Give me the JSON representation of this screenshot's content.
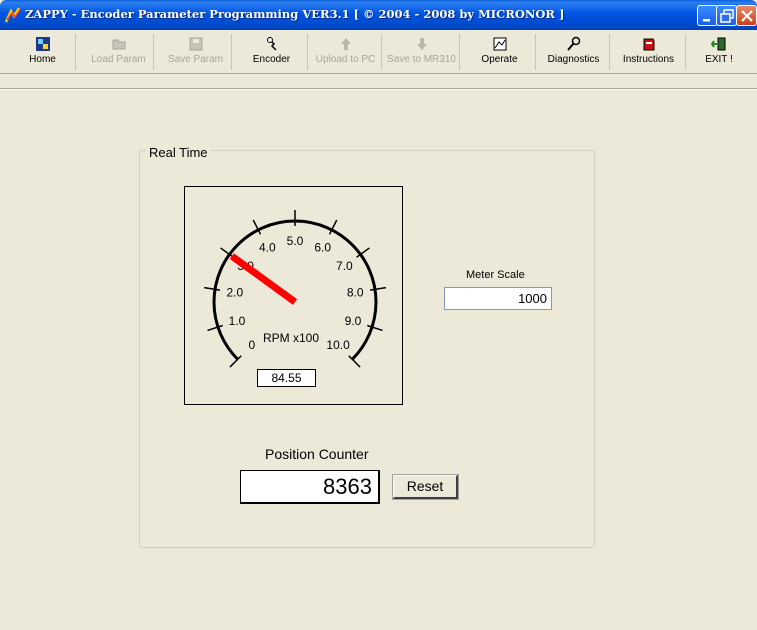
{
  "window": {
    "title": "ZAPPY - Encoder Parameter Programming  VER3.1 [ © 2004 - 2008 by MICRONOR ]"
  },
  "toolbar": {
    "items": [
      {
        "label": "Home",
        "icon": "home-icon",
        "enabled": true
      },
      {
        "label": "Load Param",
        "icon": "folder-icon",
        "enabled": false
      },
      {
        "label": "Save Param",
        "icon": "disk-icon",
        "enabled": false
      },
      {
        "label": "Encoder",
        "icon": "encoder-icon",
        "enabled": true
      },
      {
        "label": "Upload to PC",
        "icon": "up-arrow-icon",
        "enabled": false
      },
      {
        "label": "Save to MR310",
        "icon": "down-arrow-icon",
        "enabled": false
      },
      {
        "label": "Operate",
        "icon": "operate-icon",
        "enabled": true
      },
      {
        "label": "Diagnostics",
        "icon": "wrench-icon",
        "enabled": true
      },
      {
        "label": "Instructions",
        "icon": "book-icon",
        "enabled": true
      },
      {
        "label": "EXIT !",
        "icon": "exit-door-icon",
        "enabled": true
      }
    ]
  },
  "realtime": {
    "group_title": "Real Time",
    "gauge": {
      "unit_label": "RPM x100",
      "ticks": [
        "0",
        "1.0",
        "2.0",
        "3.0",
        "4.0",
        "5.0",
        "6.0",
        "7.0",
        "8.0",
        "9.0",
        "10.0"
      ],
      "min": 0,
      "max": 10,
      "needle_value": 3.0,
      "value_display": "84.55",
      "needle_color": "#ff0000"
    },
    "meter_scale": {
      "label": "Meter Scale",
      "value": "1000"
    },
    "position_counter": {
      "label": "Position Counter",
      "value": "8363",
      "reset_label": "Reset"
    }
  }
}
